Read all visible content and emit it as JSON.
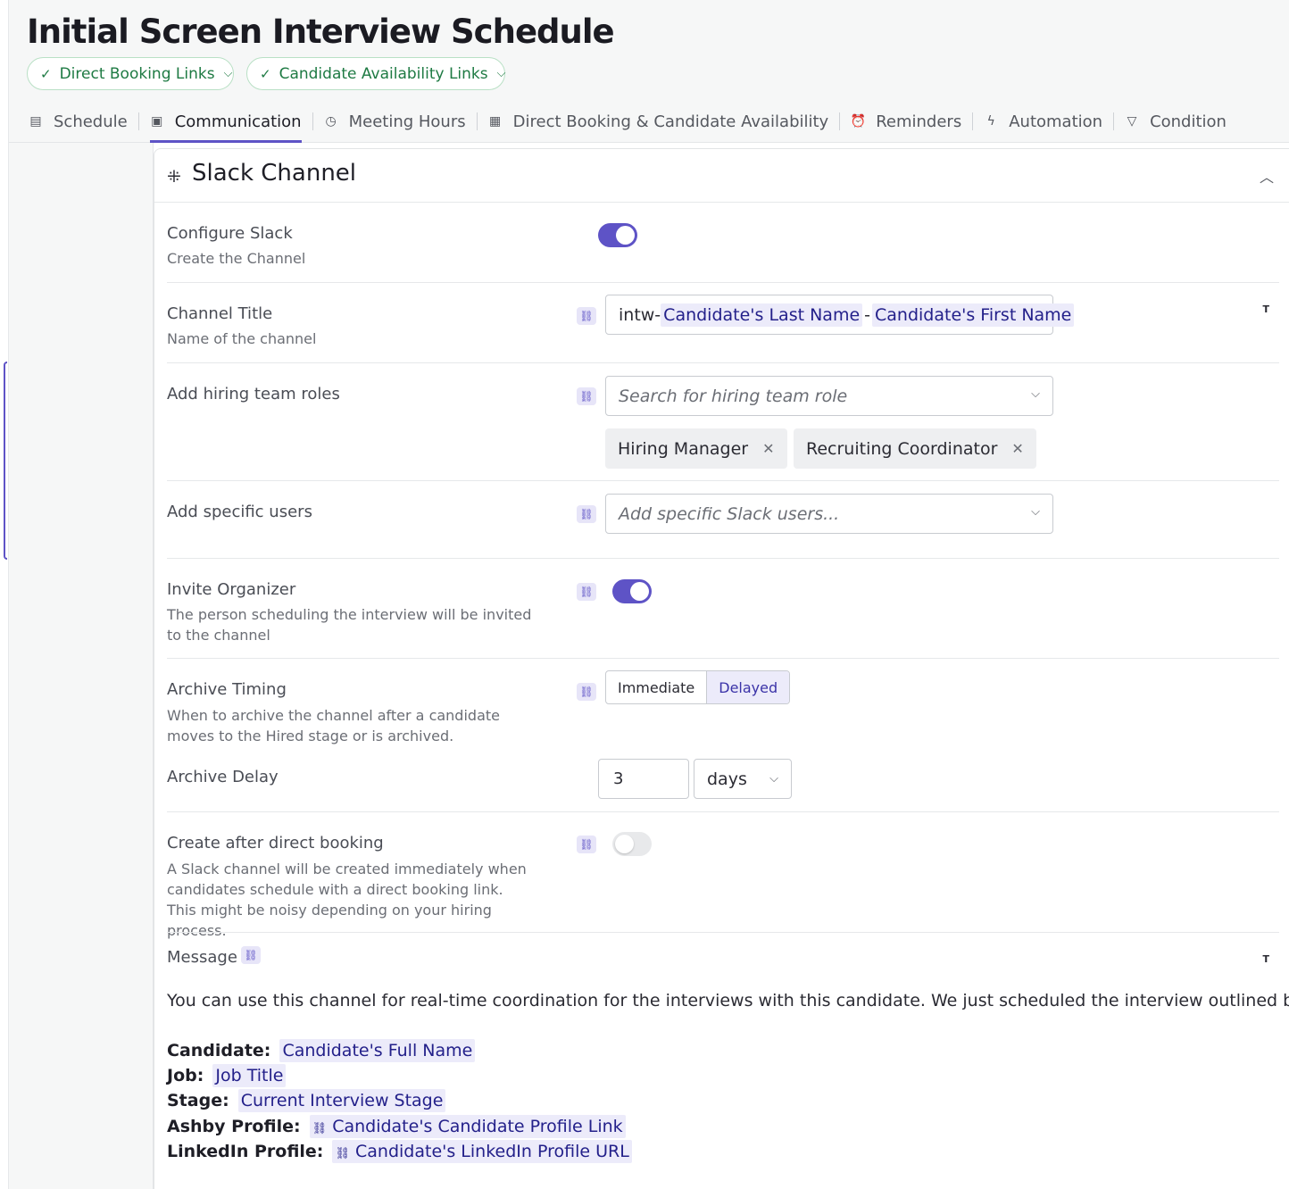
{
  "header": {
    "title": "Initial Screen Interview Schedule",
    "status_pills": [
      {
        "label": "Direct Booking Links"
      },
      {
        "label": "Candidate Availability Links"
      }
    ]
  },
  "tabs": [
    {
      "label": "Schedule",
      "icon": "clipboard-icon"
    },
    {
      "label": "Communication",
      "icon": "calendar-icon",
      "active": true
    },
    {
      "label": "Meeting Hours",
      "icon": "clock-icon"
    },
    {
      "label": "Direct Booking & Candidate Availability",
      "icon": "calendar-grid-icon"
    },
    {
      "label": "Reminders",
      "icon": "alarm-icon"
    },
    {
      "label": "Automation",
      "icon": "lightning-icon"
    },
    {
      "label": "Condition",
      "icon": "filter-icon"
    }
  ],
  "section": {
    "title": "Slack Channel",
    "configure_slack": {
      "label": "Configure Slack",
      "description": "Create the Channel",
      "enabled": true
    },
    "channel_title": {
      "label": "Channel Title",
      "description": "Name of the channel",
      "prefix": "intw-",
      "token_1": "Candidate's Last Name",
      "separator": "-",
      "token_2": "Candidate's First Name"
    },
    "hiring_roles": {
      "label": "Add hiring team roles",
      "placeholder": "Search for hiring team role",
      "selected": [
        "Hiring Manager",
        "Recruiting Coordinator"
      ]
    },
    "specific_users": {
      "label": "Add specific users",
      "placeholder": "Add specific Slack users..."
    },
    "invite_organizer": {
      "label": "Invite Organizer",
      "description": "The person scheduling the interview will be invited to the channel",
      "enabled": true
    },
    "archive_timing": {
      "label": "Archive Timing",
      "description": "When to archive the channel after a candidate moves to the Hired stage or is archived.",
      "options": [
        "Immediate",
        "Delayed"
      ],
      "selected": "Delayed"
    },
    "archive_delay": {
      "label": "Archive Delay",
      "value": "3",
      "unit": "days"
    },
    "create_after_booking": {
      "label": "Create after direct booking",
      "description": "A Slack channel will be created immediately when candidates schedule with a direct booking link. This might be noisy depending on your hiring process.",
      "enabled": false
    },
    "message": {
      "label": "Message",
      "body": "You can use this channel for real-time coordination for the interviews with this candidate. We just scheduled the interview outlined below.",
      "fields": [
        {
          "key": "Candidate:",
          "value": "Candidate's Full Name"
        },
        {
          "key": "Job:",
          "value": "Job Title"
        },
        {
          "key": "Stage:",
          "value": "Current Interview Stage"
        },
        {
          "key": "Ashby Profile:",
          "value": "Candidate's Candidate Profile Link"
        },
        {
          "key": "LinkedIn Profile:",
          "value": "Candidate's LinkedIn Profile URL"
        }
      ]
    }
  },
  "colors": {
    "accent": "#5e53c6",
    "token_bg": "#ecebfa",
    "success": "#1e7a43"
  }
}
